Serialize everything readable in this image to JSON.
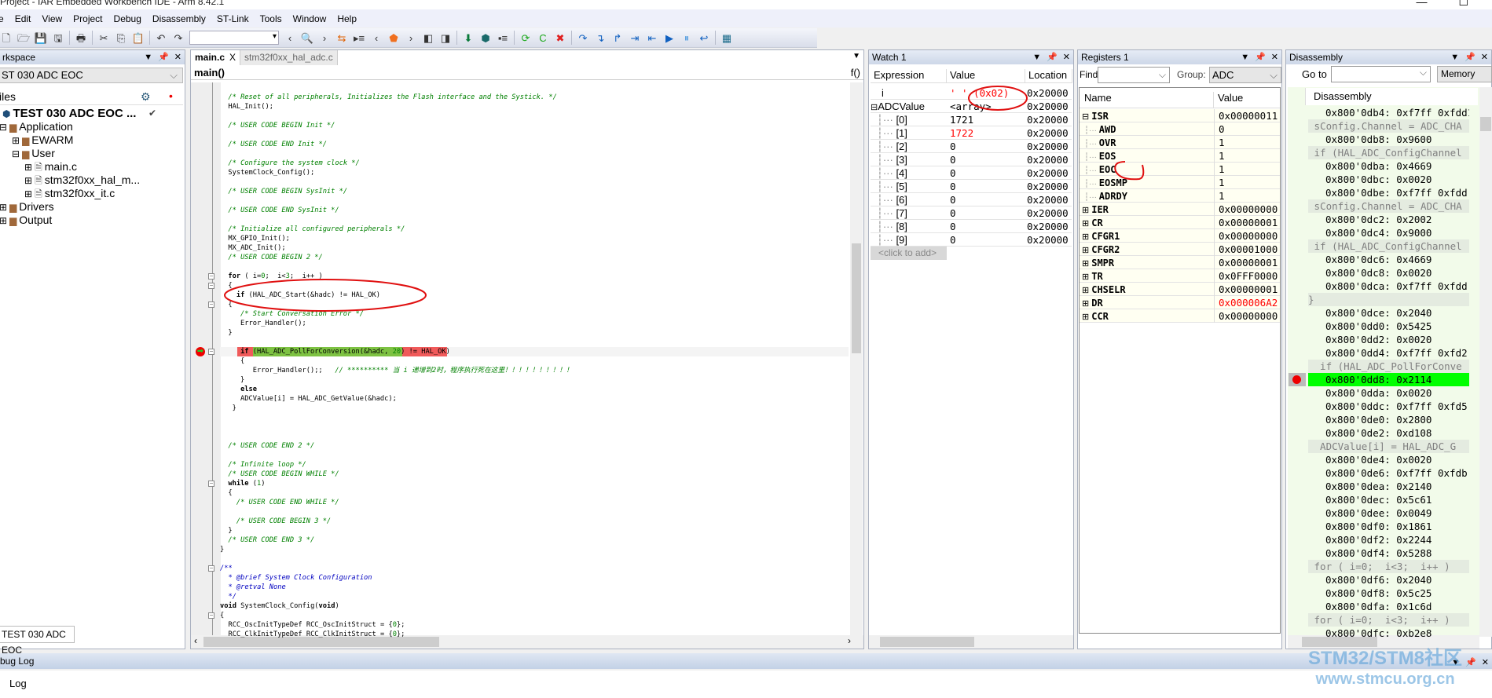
{
  "window": {
    "title": "Project - IAR Embedded Workbench IDE - Arm 8.42.1",
    "minimize": "—",
    "maximize": "☐"
  },
  "menu": [
    "e",
    "Edit",
    "View",
    "Project",
    "Debug",
    "Disassembly",
    "ST-Link",
    "Tools",
    "Window",
    "Help"
  ],
  "toolbar": [
    {
      "icon": "new-file-icon",
      "g": "🗋"
    },
    {
      "icon": "open-icon",
      "g": "🗁"
    },
    {
      "icon": "save-icon",
      "g": "💾"
    },
    {
      "icon": "save-all-icon",
      "g": "🖫"
    },
    {
      "sep": true
    },
    {
      "icon": "print-icon",
      "g": "🖶"
    },
    {
      "sep": true
    },
    {
      "icon": "cut-icon",
      "g": "✂"
    },
    {
      "icon": "copy-icon",
      "g": "⎘"
    },
    {
      "icon": "paste-icon",
      "g": "📋"
    },
    {
      "sep": true
    },
    {
      "icon": "undo-icon",
      "g": "↶"
    },
    {
      "icon": "redo-icon",
      "g": "↷"
    },
    {
      "combo": true
    },
    {
      "icon": "nav-back-icon",
      "g": "‹"
    },
    {
      "icon": "find-icon",
      "g": "🔍"
    },
    {
      "icon": "nav-forward-icon",
      "g": "›"
    },
    {
      "icon": "replace-icon",
      "g": "⇆",
      "color": "#e06000"
    },
    {
      "icon": "go-to-icon",
      "g": "▸≡"
    },
    {
      "icon": "prev-bookmark-icon",
      "g": "‹"
    },
    {
      "icon": "bookmark-icon",
      "g": "⬟",
      "color": "#f07020"
    },
    {
      "icon": "next-bookmark-icon",
      "g": "›"
    },
    {
      "icon": "prev-file-icon",
      "g": "◧"
    },
    {
      "icon": "next-file-icon",
      "g": "◨"
    },
    {
      "sep": true
    },
    {
      "icon": "download-icon",
      "g": "⬇",
      "color": "#0a7a3a"
    },
    {
      "icon": "download-debug-icon",
      "g": "⬢",
      "color": "#1a6a6a"
    },
    {
      "icon": "debug-without-download-icon",
      "g": "▪≡"
    },
    {
      "sep": true
    },
    {
      "icon": "restart-icon",
      "g": "⟳",
      "color": "#1aa81a"
    },
    {
      "icon": "go-icon",
      "g": "C",
      "color": "#1aa81a"
    },
    {
      "icon": "stop-debug-icon",
      "g": "✖",
      "color": "#e02020"
    },
    {
      "sep": true
    },
    {
      "icon": "step-over-icon",
      "g": "↷",
      "color": "#1060c0"
    },
    {
      "icon": "step-into-icon",
      "g": "↴",
      "color": "#1060c0"
    },
    {
      "icon": "step-out-icon",
      "g": "↱",
      "color": "#1060c0"
    },
    {
      "icon": "next-statement-icon",
      "g": "⇥",
      "color": "#1060c0"
    },
    {
      "icon": "run-to-cursor-icon",
      "g": "⇤",
      "color": "#1060c0"
    },
    {
      "icon": "run-icon",
      "g": "▶",
      "color": "#1060c0"
    },
    {
      "icon": "break-icon",
      "g": "⏸",
      "color": "#5aa0e0"
    },
    {
      "icon": "reset-icon",
      "g": "↩",
      "color": "#1060c0"
    },
    {
      "sep": true
    },
    {
      "icon": "layout-icon",
      "g": "▦",
      "color": "#1a6a8a"
    }
  ],
  "workspace": {
    "title": "rkspace",
    "config": "ST 030 ADC EOC",
    "files_header": "iles",
    "bottom_tab": "TEST 030 ADC EOC",
    "tree": [
      {
        "label": "TEST 030 ADC EOC ...",
        "icon": "project-icon",
        "indent": 0,
        "bold": true,
        "check": "✔"
      },
      {
        "label": "Application",
        "icon": "folder-icon",
        "indent": 1,
        "expander": "⊟"
      },
      {
        "label": "EWARM",
        "icon": "folder-icon",
        "indent": 2,
        "expander": "⊞"
      },
      {
        "label": "User",
        "icon": "folder-icon",
        "indent": 2,
        "expander": "⊟"
      },
      {
        "label": "main.c",
        "icon": "c-file-icon",
        "indent": 3,
        "expander": "⊞"
      },
      {
        "label": "stm32f0xx_hal_m...",
        "icon": "c-file-icon",
        "indent": 3,
        "expander": "⊞"
      },
      {
        "label": "stm32f0xx_it.c",
        "icon": "c-file-icon",
        "indent": 3,
        "expander": "⊞"
      },
      {
        "label": "Drivers",
        "icon": "folder-icon",
        "indent": 1,
        "expander": "⊞"
      },
      {
        "label": "Output",
        "icon": "folder-icon",
        "indent": 1,
        "expander": "⊞"
      }
    ]
  },
  "editor": {
    "tabs": [
      {
        "label": "main.c",
        "active": true,
        "close": "X"
      },
      {
        "label": "stm32f0xx_hal_adc.c",
        "active": false
      }
    ],
    "function": "main()",
    "func_icon": "f()",
    "lines": [
      [
        [
          "/* Reset of all peripherals, Initializes the Flash interface and the Systick. */",
          "c"
        ]
      ],
      [
        [
          "HAL_Init();",
          ""
        ]
      ],
      [],
      [
        [
          "/* USER CODE BEGIN Init */",
          "c"
        ]
      ],
      [],
      [
        [
          "/* USER CODE END Init */",
          "c"
        ]
      ],
      [],
      [
        [
          "/* Configure the system clock */",
          "c"
        ]
      ],
      [
        [
          "SystemClock_Config();",
          ""
        ]
      ],
      [],
      [
        [
          "/* USER CODE BEGIN SysInit */",
          "c"
        ]
      ],
      [],
      [
        [
          "/* USER CODE END SysInit */",
          "c"
        ]
      ],
      [],
      [
        [
          "/* Initialize all configured peripherals */",
          "c"
        ]
      ],
      [
        [
          "MX_GPIO_Init();",
          ""
        ]
      ],
      [
        [
          "MX_ADC_Init();",
          ""
        ]
      ],
      [
        [
          "/* USER CODE BEGIN 2 */",
          "c"
        ]
      ],
      [],
      [
        [
          "for",
          "k"
        ],
        [
          " ( i=",
          ""
        ],
        [
          "0",
          "n"
        ],
        [
          ";  i<",
          ""
        ],
        [
          "3",
          "n"
        ],
        [
          ";  i++ )",
          ""
        ]
      ],
      [
        [
          "{",
          ""
        ]
      ],
      [
        [
          "  ",
          ""
        ],
        [
          "if",
          "k"
        ],
        [
          " (HAL_ADC_Start(&hadc) != HAL_OK)",
          ""
        ]
      ],
      [
        [
          "{",
          ""
        ]
      ],
      [
        [
          "  /* Start Conversation Error */",
          "c"
        ]
      ],
      [
        [
          "  Error_Handler();",
          ""
        ]
      ],
      [
        [
          "}",
          ""
        ]
      ],
      [],
      [
        [
          "  ",
          ""
        ],
        [
          "if",
          "k"
        ],
        [
          " (HAL_ADC_PollForConversion(&hadc, ",
          ""
        ],
        [
          "20",
          "n"
        ],
        [
          ") != HAL_OK)",
          ""
        ]
      ],
      [
        [
          "  {",
          ""
        ]
      ],
      [
        [
          "     Error_Handler();;   ",
          ""
        ],
        [
          "// ********** 当 i 递增到2时，程序执行死在这里！！！！！！！！！！",
          "c"
        ]
      ],
      [
        [
          "  }",
          ""
        ]
      ],
      [
        [
          "  ",
          ""
        ],
        [
          "else",
          "k"
        ]
      ],
      [
        [
          "  ADCValue[i] = HAL_ADC_GetValue(&hadc);",
          ""
        ]
      ],
      [
        [
          "}",
          ""
        ]
      ],
      [],
      [],
      [],
      [
        [
          "/* USER CODE END 2 */",
          "c"
        ]
      ],
      [],
      [
        [
          "/* Infinite loop */",
          "c"
        ]
      ],
      [
        [
          "/* USER CODE BEGIN WHILE */",
          "c"
        ]
      ],
      [
        [
          "while",
          "k"
        ],
        [
          " (",
          ""
        ],
        [
          "1",
          "n"
        ],
        [
          ")",
          ""
        ]
      ],
      [
        [
          "{",
          ""
        ]
      ],
      [
        [
          "  /* USER CODE END WHILE */",
          "c"
        ]
      ],
      [],
      [
        [
          "  /* USER CODE BEGIN 3 */",
          "c"
        ]
      ],
      [
        [
          "}",
          ""
        ]
      ],
      [
        [
          "/* USER CODE END 3 */",
          "c"
        ]
      ],
      [
        [
          "}",
          ""
        ]
      ],
      [],
      [
        [
          "/**",
          "d"
        ]
      ],
      [
        [
          "  * @brief System Clock Configuration",
          "d"
        ]
      ],
      [
        [
          "  * @retval None",
          "d"
        ]
      ],
      [
        [
          "  */",
          "d"
        ]
      ],
      [
        [
          "void",
          "k"
        ],
        [
          " SystemClock_Config(",
          ""
        ],
        [
          "void",
          "k"
        ],
        [
          ")",
          ""
        ]
      ],
      [
        [
          "{",
          ""
        ]
      ],
      [
        [
          "  RCC_OscInitTypeDef RCC_OscInitStruct = {",
          ""
        ],
        [
          "0",
          "n"
        ],
        [
          "};",
          ""
        ]
      ],
      [
        [
          "  RCC_ClkInitTypeDef RCC_ClkInitStruct = {",
          ""
        ],
        [
          "0",
          "n"
        ],
        [
          "};",
          ""
        ]
      ]
    ],
    "code_base_indent": [
      2,
      2,
      2,
      2,
      2,
      2,
      2,
      2,
      2,
      2,
      2,
      2,
      2,
      2,
      2,
      2,
      2,
      2,
      2,
      2,
      2,
      2,
      2,
      3,
      3,
      2,
      2,
      3,
      3,
      3,
      3,
      3,
      3,
      3,
      2,
      2,
      2,
      2,
      2,
      2,
      2,
      2,
      2,
      2,
      2,
      2,
      2,
      2,
      0,
      0,
      0,
      0,
      0,
      0,
      0,
      0,
      0,
      0
    ],
    "current_line": 27
  },
  "watch": {
    "title": "Watch 1",
    "columns": [
      "Expression",
      "Value",
      "Location"
    ],
    "rows": [
      {
        "expr": "i",
        "value": "' ' (0x02)",
        "loc": "0x20000",
        "changed": true
      },
      {
        "expr": "ADCValue",
        "value": "<array>",
        "loc": "0x20000",
        "expander": "⊟"
      },
      {
        "expr": "[0]",
        "value": "1721",
        "loc": "0x20000",
        "child": true
      },
      {
        "expr": "[1]",
        "value": "1722",
        "loc": "0x20000",
        "child": true,
        "changed": true
      },
      {
        "expr": "[2]",
        "value": "0",
        "loc": "0x20000",
        "child": true
      },
      {
        "expr": "[3]",
        "value": "0",
        "loc": "0x20000",
        "child": true
      },
      {
        "expr": "[4]",
        "value": "0",
        "loc": "0x20000",
        "child": true
      },
      {
        "expr": "[5]",
        "value": "0",
        "loc": "0x20000",
        "child": true
      },
      {
        "expr": "[6]",
        "value": "0",
        "loc": "0x20000",
        "child": true
      },
      {
        "expr": "[7]",
        "value": "0",
        "loc": "0x20000",
        "child": true
      },
      {
        "expr": "[8]",
        "value": "0",
        "loc": "0x20000",
        "child": true
      },
      {
        "expr": "[9]",
        "value": "0",
        "loc": "0x20000",
        "child": true
      }
    ],
    "add_placeholder": "<click to add>"
  },
  "registers": {
    "title": "Registers 1",
    "find_label": "Find:",
    "find_value": "",
    "group_label": "Group:",
    "group_value": "ADC",
    "columns": [
      "Name",
      "Value"
    ],
    "rows": [
      {
        "name": "ISR",
        "value": "0x00000011",
        "expander": "⊟"
      },
      {
        "name": "AWD",
        "value": "0",
        "child": true
      },
      {
        "name": "OVR",
        "value": "1",
        "child": true
      },
      {
        "name": "EOS",
        "value": "1",
        "child": true
      },
      {
        "name": "EOC",
        "value": "1",
        "child": true
      },
      {
        "name": "EOSMP",
        "value": "1",
        "child": true
      },
      {
        "name": "ADRDY",
        "value": "1",
        "child": true
      },
      {
        "name": "IER",
        "value": "0x00000000",
        "expander": "⊞"
      },
      {
        "name": "CR",
        "value": "0x00000001",
        "expander": "⊞"
      },
      {
        "name": "CFGR1",
        "value": "0x00000000",
        "expander": "⊞"
      },
      {
        "name": "CFGR2",
        "value": "0x00001000",
        "expander": "⊞"
      },
      {
        "name": "SMPR",
        "value": "0x00000001",
        "expander": "⊞"
      },
      {
        "name": "TR",
        "value": "0x0FFF0000",
        "expander": "⊞"
      },
      {
        "name": "CHSELR",
        "value": "0x00000001",
        "expander": "⊞"
      },
      {
        "name": "DR",
        "value": "0x000006A2",
        "expander": "⊞",
        "changed": true
      },
      {
        "name": "CCR",
        "value": "0x00000000",
        "expander": "⊞"
      }
    ]
  },
  "disassembly": {
    "title": "Disassembly",
    "goto_label": "Go to",
    "goto_value": "",
    "memory_button": "Memory",
    "column": "Disassembly",
    "rows": [
      {
        "t": "0x800'0db4: 0xf7ff 0xfdd1"
      },
      {
        "t": " sConfig.Channel = ADC_CHA",
        "src": true
      },
      {
        "t": "0x800'0db8: 0x9600"
      },
      {
        "t": " if (HAL_ADC_ConfigChannel",
        "src": true
      },
      {
        "t": "0x800'0dba: 0x4669"
      },
      {
        "t": "0x800'0dbc: 0x0020"
      },
      {
        "t": "0x800'0dbe: 0xf7ff 0xfdd"
      },
      {
        "t": " sConfig.Channel = ADC_CHA",
        "src": true
      },
      {
        "t": "0x800'0dc2: 0x2002"
      },
      {
        "t": "0x800'0dc4: 0x9000"
      },
      {
        "t": " if (HAL_ADC_ConfigChannel",
        "src": true
      },
      {
        "t": "0x800'0dc6: 0x4669"
      },
      {
        "t": "0x800'0dc8: 0x0020"
      },
      {
        "t": "0x800'0dca: 0xf7ff 0xfdd"
      },
      {
        "t": "}",
        "src": true,
        "flush": true
      },
      {
        "t": "0x800'0dce: 0x2040"
      },
      {
        "t": "0x800'0dd0: 0x5425"
      },
      {
        "t": "0x800'0dd2: 0x0020"
      },
      {
        "t": "0x800'0dd4: 0xf7ff 0xfd2"
      },
      {
        "t": "  if (HAL_ADC_PollForConve",
        "src": true
      },
      {
        "t": "0x800'0dd8: 0x2114",
        "current": true,
        "breakpoint": true
      },
      {
        "t": "0x800'0dda: 0x0020"
      },
      {
        "t": "0x800'0ddc: 0xf7ff 0xfd5"
      },
      {
        "t": "0x800'0de0: 0x2800"
      },
      {
        "t": "0x800'0de2: 0xd108"
      },
      {
        "t": "  ADCValue[i] = HAL_ADC_G",
        "src": true
      },
      {
        "t": "0x800'0de4: 0x0020"
      },
      {
        "t": "0x800'0de6: 0xf7ff 0xfdb"
      },
      {
        "t": "0x800'0dea: 0x2140"
      },
      {
        "t": "0x800'0dec: 0x5c61"
      },
      {
        "t": "0x800'0dee: 0x0049"
      },
      {
        "t": "0x800'0df0: 0x1861"
      },
      {
        "t": "0x800'0df2: 0x2244"
      },
      {
        "t": "0x800'0df4: 0x5288"
      },
      {
        "t": " for ( i=0;  i<3;  i++ )",
        "src": true
      },
      {
        "t": "0x800'0df6: 0x2040"
      },
      {
        "t": "0x800'0df8: 0x5c25"
      },
      {
        "t": "0x800'0dfa: 0x1c6d"
      },
      {
        "t": " for ( i=0;  i<3;  i++ )",
        "src": true
      },
      {
        "t": "0x800'0dfc: 0xb2e8"
      }
    ]
  },
  "debug_log": {
    "title": "bug Log",
    "column": "Log"
  },
  "watermark": {
    "line1": "STM32/STM8社区",
    "line2": "www.stmcu.org.cn"
  },
  "colors": {
    "changed": "#ff0000",
    "current_line_green": "#7dc242",
    "current_line_red": "#f05a5a",
    "disasm_current": "#00ff00",
    "annotation": "#e01010"
  }
}
